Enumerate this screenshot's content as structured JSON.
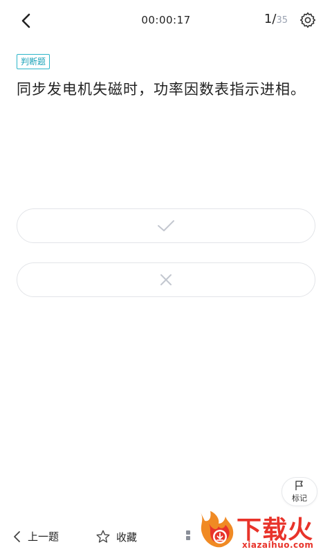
{
  "header": {
    "timer": "00:00:17",
    "current_index": "1/",
    "total": "35"
  },
  "question": {
    "type_label": "判断题",
    "text": "同步发电机失磁时，功率因数表指示进相。"
  },
  "options": [
    {
      "icon": "check-icon"
    },
    {
      "icon": "cross-icon"
    }
  ],
  "mark": {
    "label": "标记"
  },
  "bottom_bar": {
    "prev_label": "上一题",
    "favorite_label": "收藏"
  },
  "watermark": {
    "text_cn": "下载火",
    "text_en": "xiazaihuo.com"
  },
  "colors": {
    "accent": "#1aa2b8",
    "watermark": "#e8332a",
    "border": "#e2e4e8"
  }
}
